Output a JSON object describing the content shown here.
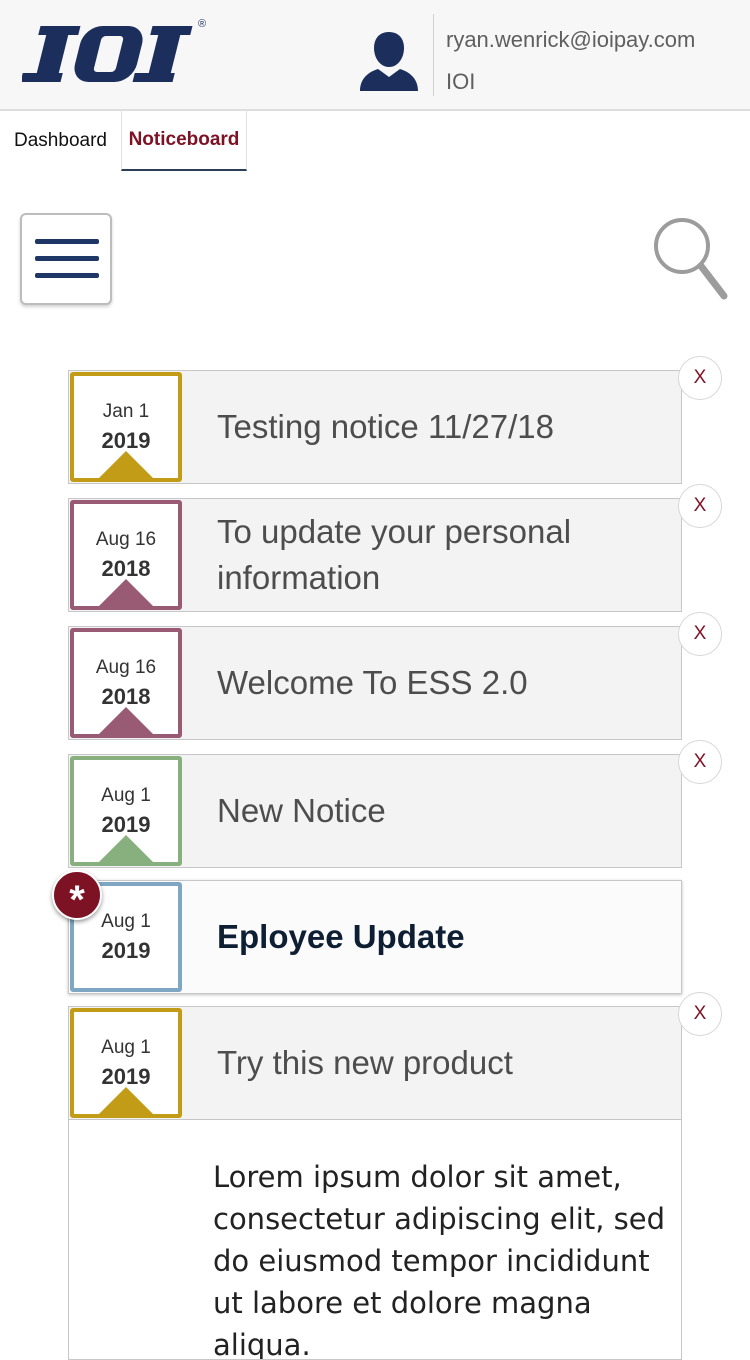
{
  "header": {
    "logo_text": "IOI",
    "logo_mark": "®",
    "user_email": "ryan.wenrick@ioipay.com",
    "user_company": "IOI",
    "avatar_icon": "user-avatar-icon"
  },
  "tabs": [
    {
      "label": "Dashboard",
      "active": false
    },
    {
      "label": "Noticeboard",
      "active": true
    }
  ],
  "toolbar": {
    "menu_icon": "hamburger-menu-icon",
    "search_icon": "magnifier-icon"
  },
  "colors": {
    "brand_navy": "#1c2e5c",
    "accent_maroon": "#7d1224",
    "gold": "#c39c17",
    "mauve": "#995a73",
    "green": "#87b07e",
    "blue": "#7fa6c2"
  },
  "notices": [
    {
      "month_day": "Jan 1",
      "year": "2019",
      "title": "Testing notice 11/27/18",
      "color": "#c39c17",
      "close_label": "X"
    },
    {
      "month_day": "Aug 16",
      "year": "2018",
      "title": "To update your personal information",
      "color": "#995a73",
      "close_label": "X"
    },
    {
      "month_day": "Aug 16",
      "year": "2018",
      "title": "Welcome To ESS 2.0",
      "color": "#995a73",
      "close_label": "X"
    },
    {
      "month_day": "Aug 1",
      "year": "2019",
      "title": "New Notice",
      "color": "#87b07e",
      "close_label": "X"
    },
    {
      "month_day": "Aug 1",
      "year": "2019",
      "title": "Eployee Update",
      "color": "#7fa6c2",
      "badge": "*"
    },
    {
      "month_day": "Aug 1",
      "year": "2019",
      "title": "Try this new product",
      "color": "#c39c17",
      "close_label": "X"
    }
  ],
  "expanded_notice": {
    "body": "Lorem ipsum dolor sit amet, consectetur adipiscing elit, sed do eiusmod tempor incididunt ut labore et dolore magna aliqua."
  }
}
